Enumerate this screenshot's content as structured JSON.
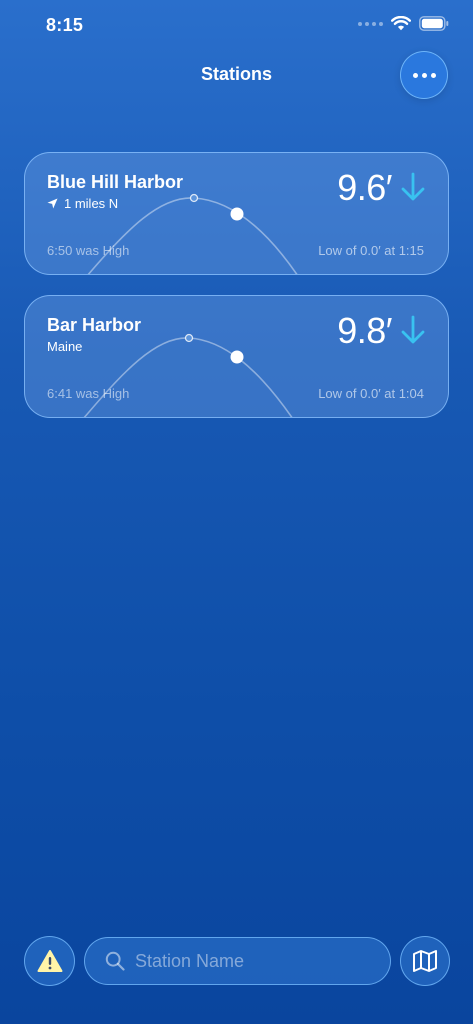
{
  "status_bar": {
    "time": "8:15",
    "icons": [
      "signal-dots-icon",
      "wifi-icon",
      "battery-icon"
    ]
  },
  "header": {
    "title": "Stations",
    "more_icon": "ellipsis-icon"
  },
  "stations": [
    {
      "name": "Blue Hill Harbor",
      "subtitle": "1 miles N",
      "subtitle_icon": "location-arrow-icon",
      "height": "9.6′",
      "trend": "falling",
      "trend_icon": "arrow-down-icon",
      "last_event": "6:50 was High",
      "next_event": "Low of 0.0′ at 1:15"
    },
    {
      "name": "Bar Harbor",
      "subtitle": "Maine",
      "height": "9.8′",
      "trend": "falling",
      "trend_icon": "arrow-down-icon",
      "last_event": "6:41 was High",
      "next_event": "Low of 0.0′ at 1:04"
    }
  ],
  "toolbar": {
    "alert_icon": "warning-icon",
    "search_placeholder": "Station Name",
    "search_value": "",
    "search_icon": "search-icon",
    "map_icon": "map-icon"
  },
  "colors": {
    "accent": "#2a78de",
    "trend_arrow": "#39c2f0",
    "warning": "#fff4a8"
  }
}
